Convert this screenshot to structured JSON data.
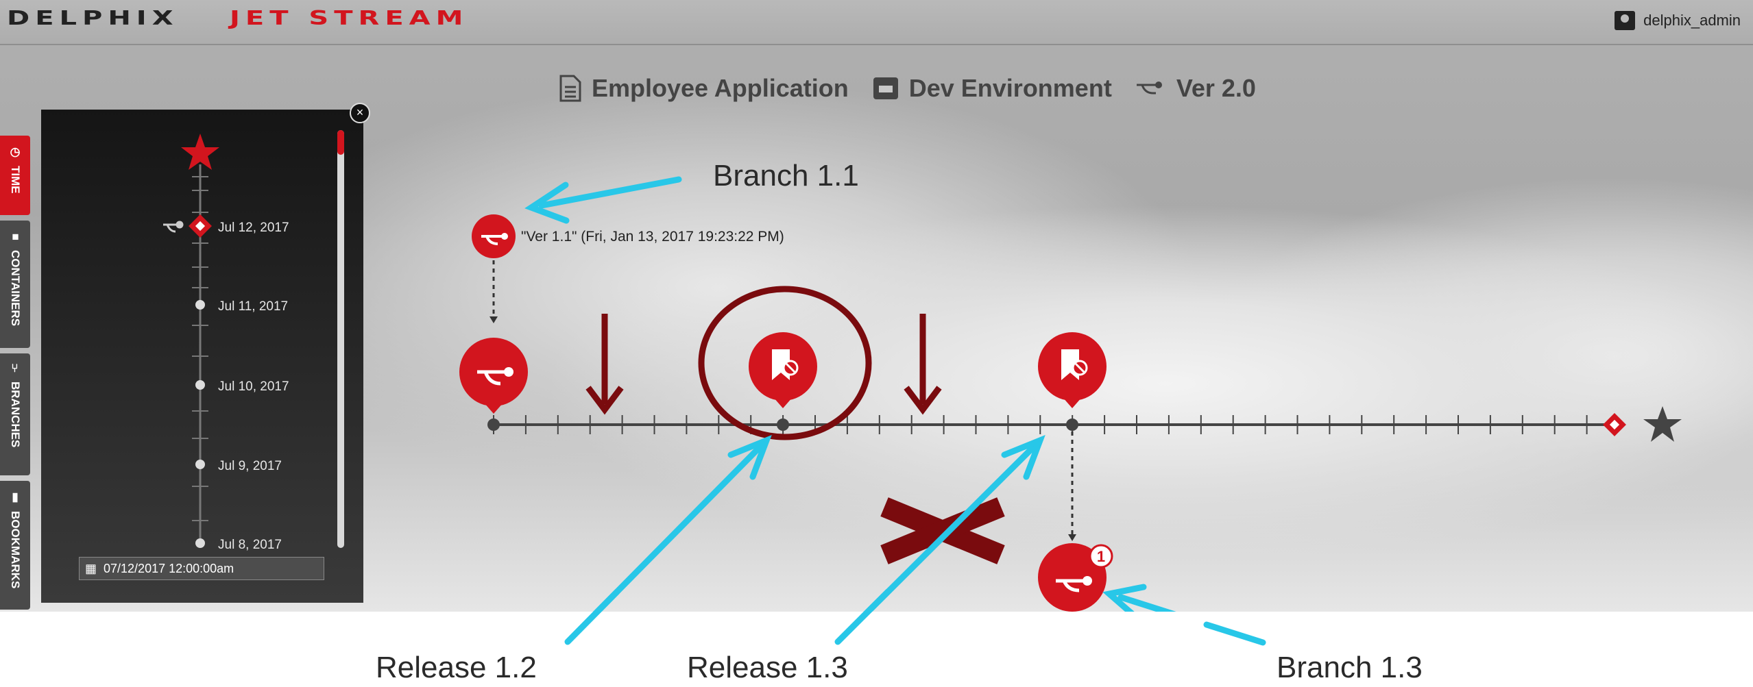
{
  "header": {
    "brand": "DELPHIX",
    "product": "JET STREAM",
    "username": "delphix_admin"
  },
  "breadcrumbs": [
    {
      "icon": "document-icon",
      "label": "Employee Application"
    },
    {
      "icon": "container-icon",
      "label": "Dev Environment"
    },
    {
      "icon": "branch-icon",
      "label": "Ver 2.0"
    }
  ],
  "side_tabs": [
    "TIME",
    "CONTAINERS",
    "BRANCHES",
    "BOOKMARKS"
  ],
  "time_panel": {
    "dates": [
      "Jul 12, 2017",
      "Jul 11, 2017",
      "Jul 10, 2017",
      "Jul 9, 2017",
      "Jul 8, 2017"
    ],
    "date_input": "07/12/2017 12:00:00am"
  },
  "timeline": {
    "branch_source_label": "\"Ver 1.1\" (Fri, Jan 13, 2017 19:23:22 PM)",
    "badge_count": "1"
  },
  "annotations": {
    "branch_11": "Branch 1.1",
    "release_12": "Release 1.2",
    "release_13": "Release 1.3",
    "branch_13": "Branch 1.3"
  },
  "colors": {
    "brand_red": "#d2151e",
    "annotation_arrow": "#28c7e8",
    "annotation_dark_red": "#7a0b0e"
  }
}
